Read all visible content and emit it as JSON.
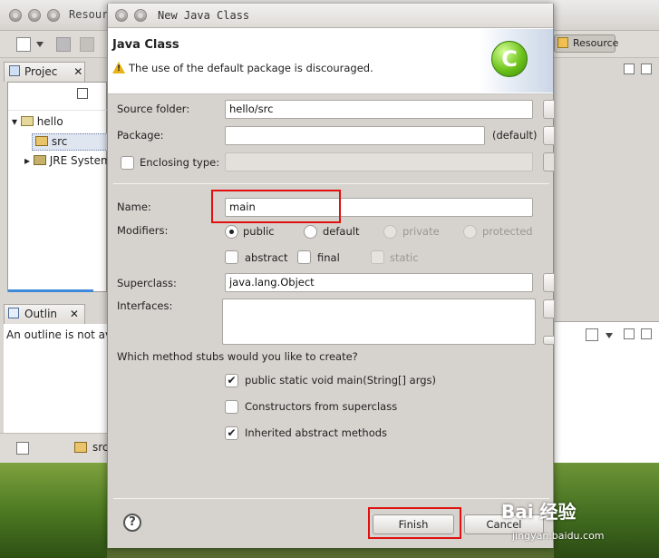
{
  "background_window": {
    "title": "Resour",
    "perspective_label": "Resource",
    "package_explorer_tab": "Projec",
    "tree": {
      "project": "hello",
      "src_folder": "src",
      "jre": "JRE System"
    },
    "outline_tab": "Outlin",
    "outline_message": "An outline is not ava",
    "bottom_item": "src"
  },
  "dialog": {
    "window_title": "New Java Class",
    "header": {
      "title": "Java Class",
      "message": "The use of the default package is discouraged.",
      "logo_letter": "C"
    },
    "source_folder": {
      "label": "Source folder:",
      "value": "hello/src"
    },
    "package": {
      "label": "Package:",
      "value": "",
      "hint": "(default)"
    },
    "enclosing_type": {
      "label": "Enclosing type:",
      "value": "",
      "checked": false
    },
    "name": {
      "label": "Name:",
      "value": "main"
    },
    "modifiers": {
      "label": "Modifiers:",
      "access": [
        "public",
        "default",
        "private",
        "protected"
      ],
      "selected": "public",
      "flags": [
        "abstract",
        "final",
        "static"
      ]
    },
    "superclass": {
      "label": "Superclass:",
      "value": "java.lang.Object"
    },
    "interfaces": {
      "label": "Interfaces:"
    },
    "stubs": {
      "question": "Which method stubs would you like to create?",
      "options": [
        {
          "label": "public static void main(String[] args)",
          "checked": true
        },
        {
          "label": "Constructors from superclass",
          "checked": false
        },
        {
          "label": "Inherited abstract methods",
          "checked": true
        }
      ]
    },
    "buttons": {
      "finish": "Finish",
      "cancel": "Cancel"
    }
  },
  "watermark": {
    "brand": "Bai 经验",
    "url": "jingyan.baidu.com"
  },
  "colors": {
    "highlight": "#e01010",
    "logo_green": "#6cc21a",
    "warning": "#e8b21a"
  }
}
